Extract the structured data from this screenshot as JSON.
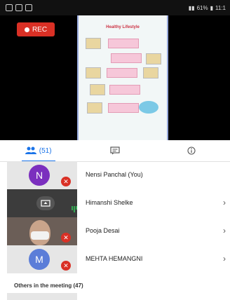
{
  "status_bar": {
    "battery": "61%",
    "time": "11:1"
  },
  "recording": {
    "label": "REC",
    "color": "#d93025"
  },
  "slide": {
    "title": "Healthy Lifestyle"
  },
  "tabs": [
    {
      "name": "people",
      "icon": "people-icon",
      "count": "(51)",
      "active": true
    },
    {
      "name": "chat",
      "icon": "chat-icon"
    },
    {
      "name": "info",
      "icon": "info-icon"
    }
  ],
  "participants": [
    {
      "name": "Nensi Panchal (You)",
      "avatar_letter": "N",
      "avatar_color": "#7b2fbe",
      "muted": true,
      "has_chevron": false
    },
    {
      "name": "Himanshi Shelke",
      "presenting": true,
      "muted": false,
      "has_chevron": true
    },
    {
      "name": "Pooja Desai",
      "video": true,
      "muted": true,
      "has_chevron": true
    },
    {
      "name": "MEHTA HEMANGNI",
      "avatar_letter": "M",
      "avatar_color": "#5b7dd8",
      "muted": true,
      "has_chevron": true
    }
  ],
  "others": {
    "label": "Others in the meeting (47)"
  }
}
